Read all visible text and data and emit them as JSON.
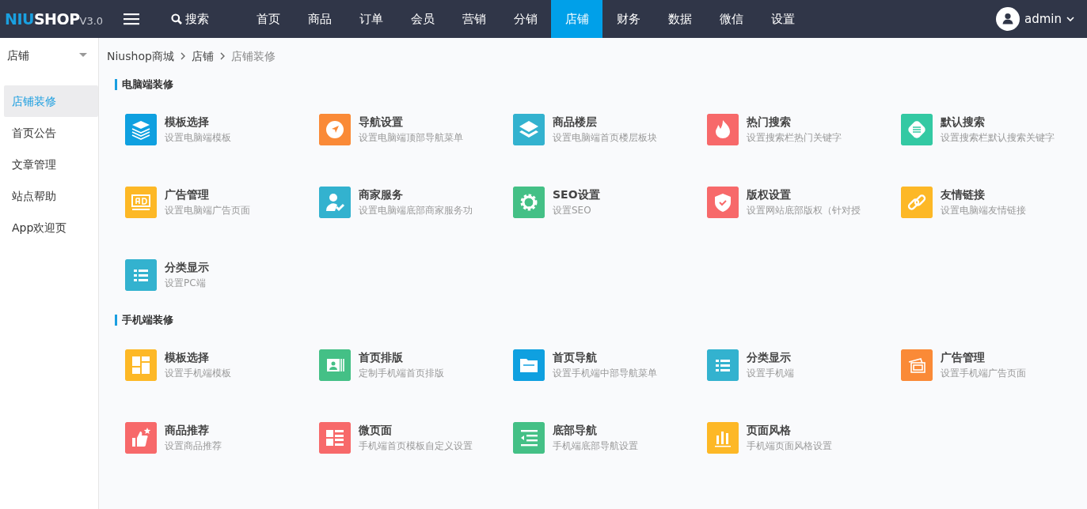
{
  "logo": {
    "accent": "NIU",
    "text": "SHOP",
    "version": "V3.0"
  },
  "search_label": "搜索",
  "nav": [
    {
      "label": "首页",
      "selected": false
    },
    {
      "label": "商品",
      "selected": false
    },
    {
      "label": "订单",
      "selected": false
    },
    {
      "label": "会员",
      "selected": false
    },
    {
      "label": "营销",
      "selected": false
    },
    {
      "label": "分销",
      "selected": false
    },
    {
      "label": "店铺",
      "selected": true
    },
    {
      "label": "财务",
      "selected": false
    },
    {
      "label": "数据",
      "selected": false
    },
    {
      "label": "微信",
      "selected": false
    },
    {
      "label": "设置",
      "selected": false
    }
  ],
  "user": {
    "name": "admin"
  },
  "sidebar": {
    "title": "店铺",
    "items": [
      {
        "label": "店铺装修",
        "selected": true
      },
      {
        "label": "首页公告",
        "selected": false
      },
      {
        "label": "文章管理",
        "selected": false
      },
      {
        "label": "站点帮助",
        "selected": false
      },
      {
        "label": "App欢迎页",
        "selected": false
      }
    ]
  },
  "breadcrumb": [
    "Niushop商城",
    "店铺",
    "店铺装修"
  ],
  "sections": [
    {
      "title": "电脑端装修",
      "tiles": [
        {
          "kind": "layers",
          "color": "#0fa0e0",
          "title": "模板选择",
          "desc": "设置电脑端模板"
        },
        {
          "kind": "navigation",
          "color": "#fa8a37",
          "title": "导航设置",
          "desc": "设置电脑端顶部导航菜单"
        },
        {
          "kind": "stack",
          "color": "#33b2cf",
          "title": "商品楼层",
          "desc": "设置电脑端首页楼层板块"
        },
        {
          "kind": "fire",
          "color": "#f7696a",
          "title": "热门搜索",
          "desc": "设置搜索栏热门关键字"
        },
        {
          "kind": "bubble",
          "color": "#33c9a3",
          "title": "默认搜索",
          "desc": "设置搜索栏默认搜索关键字"
        },
        {
          "kind": "ad",
          "color": "#fdb826",
          "title": "广告管理",
          "desc": "设置电脑端广告页面"
        },
        {
          "kind": "user",
          "color": "#33b2cf",
          "title": "商家服务",
          "desc": "设置电脑端底部商家服务功"
        },
        {
          "kind": "gear",
          "color": "#44c086",
          "title": "SEO设置",
          "desc": "设置SEO"
        },
        {
          "kind": "shield",
          "color": "#f7696a",
          "title": "版权设置",
          "desc": "设置网站底部版权（针对授"
        },
        {
          "kind": "link",
          "color": "#fdb826",
          "title": "友情链接",
          "desc": "设置电脑端友情链接"
        },
        {
          "kind": "list",
          "color": "#33b2cf",
          "title": "分类显示",
          "desc": "设置PC端"
        }
      ]
    },
    {
      "title": "手机端装修",
      "tiles": [
        {
          "kind": "grid",
          "color": "#fdb826",
          "title": "模板选择",
          "desc": "设置手机端模板"
        },
        {
          "kind": "card",
          "color": "#44c086",
          "title": "首页排版",
          "desc": "定制手机端首页排版"
        },
        {
          "kind": "folder",
          "color": "#0fa0e0",
          "title": "首页导航",
          "desc": "设置手机端中部导航菜单"
        },
        {
          "kind": "list",
          "color": "#33b2cf",
          "title": "分类显示",
          "desc": "设置手机端"
        },
        {
          "kind": "photos",
          "color": "#fa8a37",
          "title": "广告管理",
          "desc": "设置手机端广告页面"
        },
        {
          "kind": "thumb",
          "color": "#f7696a",
          "title": "商品推荐",
          "desc": "设置商品推荐"
        },
        {
          "kind": "page",
          "color": "#f7696a",
          "title": "微页面",
          "desc": "手机端首页模板自定义设置"
        },
        {
          "kind": "indent",
          "color": "#44c086",
          "title": "底部导航",
          "desc": "手机端底部导航设置"
        },
        {
          "kind": "bars",
          "color": "#fdb826",
          "title": "页面风格",
          "desc": "手机端页面风格设置"
        }
      ]
    }
  ]
}
